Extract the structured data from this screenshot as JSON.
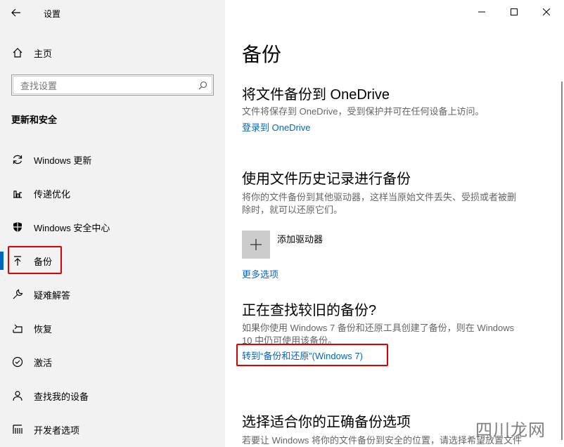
{
  "window": {
    "title": "设置"
  },
  "sidebar": {
    "home_label": "主页",
    "search_placeholder": "查找设置",
    "section_title": "更新和安全",
    "items": [
      {
        "label": "Windows 更新"
      },
      {
        "label": "传递优化"
      },
      {
        "label": "Windows 安全中心"
      },
      {
        "label": "备份"
      },
      {
        "label": "疑难解答"
      },
      {
        "label": "恢复"
      },
      {
        "label": "激活"
      },
      {
        "label": "查找我的设备"
      },
      {
        "label": "开发者选项"
      }
    ]
  },
  "main": {
    "page_title": "备份",
    "onedrive": {
      "heading": "将文件备份到 OneDrive",
      "desc": "文件将保存到 OneDrive，受到保护并可在任何设备上访问。",
      "link": "登录到 OneDrive"
    },
    "history": {
      "heading": "使用文件历史记录进行备份",
      "desc_line1": "将你的文件备份到其他驱动器，这样当原始文件丢失、受损或者被删",
      "desc_line2": "除时，就可以还原它们。",
      "add_drive": "添加驱动器",
      "more_options": "更多选项"
    },
    "older": {
      "heading": "正在查找较旧的备份?",
      "desc_line1": "如果你使用 Windows 7 备份和还原工具创建了备份，则在 Windows",
      "desc_line2": "10 中仍可使用该备份。",
      "link": "转到“备份和还原”(Windows 7)"
    },
    "choose": {
      "heading": "选择适合你的正确备份选项",
      "desc_line1": "若要让 Windows 将你的文件备份到安全的位置，请选择希望放置文件"
    }
  },
  "watermark": {
    "text": "四川龙网"
  },
  "colors": {
    "accent": "#0067c0",
    "sidebar_bg": "#f2f2f2",
    "highlight": "#e00000"
  }
}
